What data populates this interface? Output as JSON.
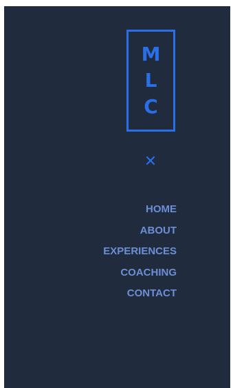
{
  "logo": {
    "letters": [
      "M",
      "L",
      "C"
    ]
  },
  "menu": {
    "close_glyph": "✕",
    "items": [
      {
        "label": "HOME"
      },
      {
        "label": "ABOUT"
      },
      {
        "label": "EXPERIENCES"
      },
      {
        "label": "COACHING"
      },
      {
        "label": "CONTACT"
      }
    ]
  },
  "colors": {
    "background": "#212b3e",
    "accent": "#2a6fe8",
    "link": "#6c8fd4"
  }
}
